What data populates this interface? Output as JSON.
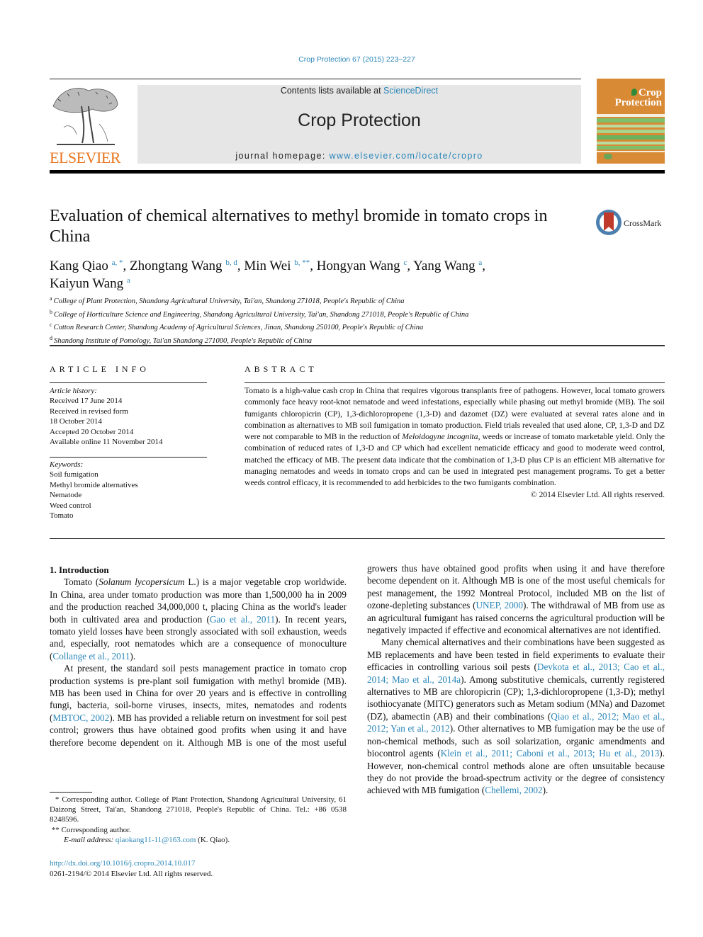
{
  "header": {
    "citation": "Crop Protection 67 (2015) 223–227",
    "contents_prefix": "Contents lists available at ",
    "contents_link": "ScienceDirect",
    "journal_name": "Crop Protection",
    "homepage_prefix": "journal homepage: ",
    "homepage_link": "www.elsevier.com/locate/cropro",
    "publisher_logo_text": "ELSEVIER",
    "cover_title_line1": "Crop",
    "cover_title_line2": "Protection",
    "brand_color": "#e87722",
    "cover_color": "#d98a35",
    "link_color": "#2a86b8"
  },
  "article": {
    "title": "Evaluation of chemical alternatives to methyl bromide in tomato crops in China",
    "crossmark_label": "CrossMark",
    "authors": [
      {
        "name": "Kang Qiao",
        "marks": "a, *"
      },
      {
        "name": "Zhongtang Wang",
        "marks": "b, d"
      },
      {
        "name": "Min Wei",
        "marks": "b, **"
      },
      {
        "name": "Hongyan Wang",
        "marks": "c"
      },
      {
        "name": "Yang Wang",
        "marks": "a"
      },
      {
        "name": "Kaiyun Wang",
        "marks": "a"
      }
    ],
    "affiliations": [
      {
        "key": "a",
        "text": "College of Plant Protection, Shandong Agricultural University, Tai'an, Shandong 271018, People's Republic of China"
      },
      {
        "key": "b",
        "text": "College of Horticulture Science and Engineering, Shandong Agricultural University, Tai'an, Shandong 271018, People's Republic of China"
      },
      {
        "key": "c",
        "text": "Cotton Research Center, Shandong Academy of Agricultural Sciences, Jinan, Shandong 250100, People's Republic of China"
      },
      {
        "key": "d",
        "text": "Shandong Institute of Pomology, Tai'an Shandong 271000, People's Republic of China"
      }
    ]
  },
  "article_info": {
    "heading": "ARTICLE INFO",
    "history_label": "Article history:",
    "history": [
      "Received 17 June 2014",
      "Received in revised form",
      "18 October 2014",
      "Accepted 20 October 2014",
      "Available online 11 November 2014"
    ],
    "keywords_label": "Keywords:",
    "keywords": [
      "Soil fumigation",
      "Methyl bromide alternatives",
      "Nematode",
      "Weed control",
      "Tomato"
    ]
  },
  "abstract": {
    "heading": "ABSTRACT",
    "text_part1": "Tomato is a high-value cash crop in China that requires vigorous transplants free of pathogens. However, local tomato growers commonly face heavy root-knot nematode and weed infestations, especially while phasing out methyl bromide (MB). The soil fumigants chloropicrin (CP), 1,3-dichloropropene (1,3-D) and dazomet (DZ) were evaluated at several rates alone and in combination as alternatives to MB soil fumigation in tomato production. Field trials revealed that used alone, CP, 1,3-D and DZ were not comparable to MB in the reduction of ",
    "text_italic": "Meloidogyne incognita",
    "text_part2": ", weeds or increase of tomato marketable yield. Only the combination of reduced rates of 1,3-D and CP which had excellent nematicide efficacy and good to moderate weed control, matched the efficacy of MB. The present data indicate that the combination of 1,3-D plus CP is an efficient MB alternative for managing nematodes and weeds in tomato crops and can be used in integrated pest management programs. To get a better weeds control efficacy, it is recommended to add herbicides to the two fumigants combination.",
    "copyright": "© 2014 Elsevier Ltd. All rights reserved."
  },
  "introduction": {
    "heading": "1.  Introduction",
    "p1": {
      "a": "Tomato (",
      "italic": "Solanum lycopersicum",
      "b": " L.) is a major vegetable crop worldwide. In China, area under tomato production was more than 1,500,000 ha in 2009 and the production reached 34,000,000 t, placing China as the world's leader both in cultivated area and production (",
      "ref1": "Gao et al., 2011",
      "c": "). In recent years, tomato yield losses have been strongly associated with soil exhaustion, weeds and, especially, root nematodes which are a consequence of monoculture (",
      "ref2": "Collange et al., 2011",
      "d": ")."
    },
    "p2": {
      "a": "At present, the standard soil pests management practice in tomato crop production systems is pre-plant soil fumigation with methyl bromide (MB). MB has been used in China for over 20 years and is effective in controlling fungi, bacteria, soil-borne viruses, insects, mites, nematodes and rodents (",
      "ref1": "MBTOC, 2002",
      "b": "). MB has provided a reliable return on investment for soil pest control; growers thus have obtained good profits when using it and have therefore become dependent on it. Although MB is one of the most useful chemicals for pest management, the 1992 Montreal Protocol, included MB on the list of ozone-depleting substances (",
      "ref2": "UNEP, 2000",
      "c": "). The withdrawal of MB from use as an agricultural fumigant has raised concerns the agricultural production will be negatively impacted if effective and economical alternatives are not identified."
    },
    "p3": {
      "a": "Many chemical alternatives and their combinations have been suggested as MB replacements and have been tested in field experiments to evaluate their efficacies in controlling various soil pests (",
      "ref1": "Devkota et al., 2013; Cao et al., 2014; Mao et al., 2014a",
      "b": "). Among substitutive chemicals, currently registered alternatives to MB are chloropicrin (CP); 1,3-dichloropropene (1,3-D); methyl isothiocyanate (MITC) generators such as Metam sodium (MNa) and Dazomet (DZ), abamectin (AB) and their combinations (",
      "ref2": "Qiao et al., 2012; Mao et al., 2012; Yan et al., 2012",
      "c": "). Other alternatives to MB fumigation may be the use of non-chemical methods, such as soil solarization, organic amendments and biocontrol agents (",
      "ref3": "Klein et al., 2011; Caboni et al., 2013; Hu et al., 2013",
      "d": "). However, non-chemical control methods alone are often unsuitable because they do not provide the broad-spectrum activity or the degree of consistency achieved with MB fumigation (",
      "ref4": "Chellemi, 2002",
      "e": ")."
    }
  },
  "footnotes": {
    "star1_mark": "*",
    "star1_text": "Corresponding author. College of Plant Protection, Shandong Agricultural University, 61 Daizong Street, Tai'an, Shandong 271018, People's Republic of China. Tel.: +86 0538 8248596.",
    "star2_mark": "**",
    "star2_text": "Corresponding author.",
    "email_label": "E-mail address:",
    "email": "qiaokang11-11@163.com",
    "email_suffix": " (K. Qiao).",
    "doi_link": "http://dx.doi.org/10.1016/j.cropro.2014.10.017",
    "issn_line": "0261-2194/© 2014 Elsevier Ltd. All rights reserved."
  }
}
